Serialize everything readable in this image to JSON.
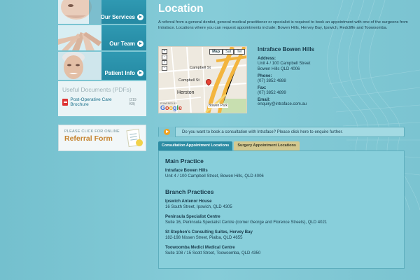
{
  "sidebar": {
    "nav": [
      {
        "label": "Our Services"
      },
      {
        "label": "Our Team"
      },
      {
        "label": "Patient Info"
      }
    ],
    "documents": {
      "title": "Useful Documents (PDFs)",
      "items": [
        {
          "label": "Post-Operative Care Brochure",
          "size": "(219 KB)"
        }
      ]
    },
    "referral": {
      "small": "PLEASE CLICK FOR ONLINE",
      "big": "Referral Form"
    }
  },
  "main": {
    "title": "Location",
    "intro": "A referral from a general dentist, general medical practitioner or specialist is required to book an appointment with one of the surgeons from Intraface. Locations where you can request appointments include; Bowen Hills, Hervey Bay, Ipswich, Redcliffe and Toowoomba.",
    "map": {
      "buttons": [
        "Map",
        "Sat",
        "Ter"
      ],
      "zoom": [
        "+",
        "-",
        "+",
        "-"
      ],
      "street_labels": [
        "Campbell St",
        "Campbell St",
        "Herston",
        "Bowen Park"
      ],
      "powered_by": "POWERED BY",
      "google": [
        "G",
        "o",
        "o",
        "g",
        "l",
        "e"
      ]
    },
    "address_block": {
      "title": "Intraface Bowen Hills",
      "address_label": "Address:",
      "address_lines": [
        "Unit 4 / 100 Campbell Street",
        "Bowen Hills QLD 4006"
      ],
      "phone_label": "Phone:",
      "phone": "(07) 3852 4888",
      "fax_label": "Fax:",
      "fax": "(07) 3852 4899",
      "email_label": "Email:",
      "email": "enquiry@intraface.com.au"
    },
    "consult_bar": "Do you want to book a consultation with Intraface? Please click here to enquire further.",
    "tabs": [
      "Consultation Appointment Locations",
      "Surgery Appointment Locations"
    ],
    "panel": {
      "main_title": "Main Practice",
      "main_location": {
        "name": "Intraface Bowen Hills",
        "address": "Unit 4 / 100 Campbell Street, Bowen Hills, QLD 4006"
      },
      "branch_title": "Branch Practices",
      "branches": [
        {
          "name": "Ipswich Antenor House",
          "address": "16 South Street, Ipswich, QLD 4305"
        },
        {
          "name": "Peninsula Specialist Centre",
          "address": "Suite 16, Peninsula Specialist Centre (corner George and Florence Streets), QLD 4021"
        },
        {
          "name": "St Stephen's Consulting Suites, Hervey Bay",
          "address": "182-198 Nissen Street, Pialba, QLD 4655"
        },
        {
          "name": "Toowoomba Medici Medical Centre",
          "address": "Suite 108 / 15 Scott Street, Toowoomba, QLD 4350"
        }
      ]
    }
  },
  "colors": {
    "background": "#7cc6d3",
    "nav_tile": "#2589a3",
    "accent_orange": "#c5832e",
    "tab_active": "#2d8ca4",
    "tab_inactive": "#d3c88f"
  }
}
